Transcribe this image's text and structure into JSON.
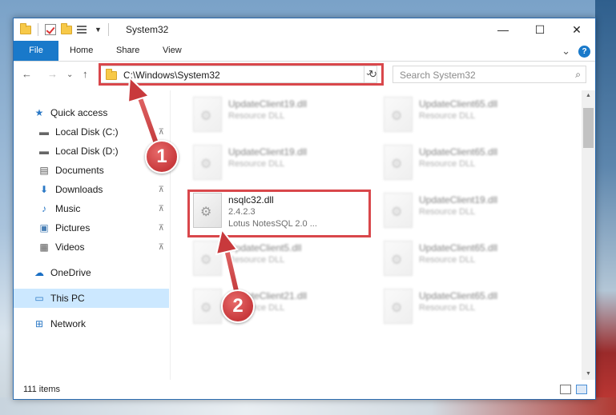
{
  "window": {
    "title": "System32",
    "controls": {
      "minimize": "—",
      "maximize": "☐",
      "close": "✕"
    }
  },
  "ribbon": {
    "tabs": [
      "File",
      "Home",
      "Share",
      "View"
    ],
    "expand_glyph": "⌄",
    "help_glyph": "?"
  },
  "navigation": {
    "back": "←",
    "forward": "→",
    "recent": "⌄",
    "up": "↑",
    "address": "C:\\Windows\\System32",
    "address_dropdown": "⌄",
    "refresh": "↻",
    "search_placeholder": "Search System32",
    "search_glyph": "⌕"
  },
  "sidebar": {
    "items": [
      {
        "label": "Quick access",
        "icon": "star-icon",
        "glyph": "★",
        "pinned": false
      },
      {
        "label": "Local Disk (C:)",
        "icon": "drive-icon",
        "glyph": "▬",
        "pinned": true
      },
      {
        "label": "Local Disk (D:)",
        "icon": "drive-icon",
        "glyph": "▬",
        "pinned": true
      },
      {
        "label": "Documents",
        "icon": "documents-icon",
        "glyph": "▤",
        "pinned": true
      },
      {
        "label": "Downloads",
        "icon": "downloads-icon",
        "glyph": "⬇",
        "pinned": true
      },
      {
        "label": "Music",
        "icon": "music-icon",
        "glyph": "♪",
        "pinned": true
      },
      {
        "label": "Pictures",
        "icon": "pictures-icon",
        "glyph": "▣",
        "pinned": true
      },
      {
        "label": "Videos",
        "icon": "videos-icon",
        "glyph": "▦",
        "pinned": true
      },
      {
        "label": "OneDrive",
        "icon": "onedrive-icon",
        "glyph": "☁",
        "pinned": false
      },
      {
        "label": "This PC",
        "icon": "this-pc-icon",
        "glyph": "▭",
        "pinned": false,
        "selected": true
      },
      {
        "label": "Network",
        "icon": "network-icon",
        "glyph": "⊞",
        "pinned": false
      }
    ],
    "pin_glyph": "📌"
  },
  "files": [
    {
      "name": "UpdateClient19.dll",
      "line2": "Resource DLL",
      "line3": "",
      "blurred": true
    },
    {
      "name": "UpdateClient65.dll",
      "line2": "Resource DLL",
      "line3": "",
      "blurred": true
    },
    {
      "name": "UpdateClient19.dll",
      "line2": "Resource DLL",
      "line3": "",
      "blurred": true
    },
    {
      "name": "UpdateClient65.dll",
      "line2": "Resource DLL",
      "line3": "",
      "blurred": true
    },
    {
      "name": "nsqlc32.dll",
      "line2": "2.4.2.3",
      "line3": "Lotus NotesSQL 2.0 ...",
      "blurred": false
    },
    {
      "name": "UpdateClient19.dll",
      "line2": "Resource DLL",
      "line3": "",
      "blurred": true
    },
    {
      "name": "UpdateClient5.dll",
      "line2": "Resource DLL",
      "line3": "",
      "blurred": true
    },
    {
      "name": "UpdateClient65.dll",
      "line2": "Resource DLL",
      "line3": "",
      "blurred": true
    },
    {
      "name": "UpdateClient21.dll",
      "line2": "Resource DLL",
      "line3": "",
      "blurred": true
    },
    {
      "name": "UpdateClient65.dll",
      "line2": "Resource DLL",
      "line3": "",
      "blurred": true
    }
  ],
  "status": {
    "item_count": "111 items"
  },
  "annotations": {
    "step1": "1",
    "step2": "2",
    "highlight_color": "#d9474b"
  }
}
